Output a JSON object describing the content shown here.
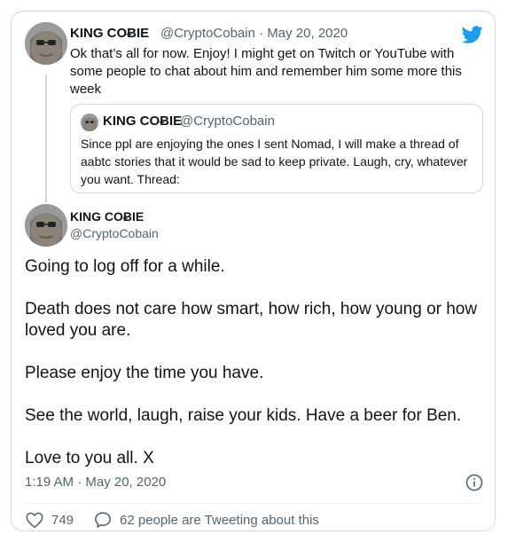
{
  "reply_tweet": {
    "author_name": "KING COɃIE",
    "author_handle": "@CryptoCobain",
    "separator": "·",
    "date": "May 20, 2020",
    "text": "Ok that’s all for now. Enjoy! I might get on Twitch or YouTube with some people to chat about him and remember him some more this week"
  },
  "quoted_tweet": {
    "author_name": "KING COɃIE",
    "author_handle": "@CryptoCobain",
    "text": "Since ppl are enjoying the ones I sent Nomad, I will make a thread of aabtc stories that it would be sad to keep private. Laugh, cry, whatever you want. Thread:"
  },
  "main_tweet": {
    "author_name": "KING COɃIE",
    "author_handle": "@CryptoCobain",
    "paragraphs": [
      "Going to log off for a while.",
      "Death does not care how smart, how rich, how young or how loved you are.",
      "Please enjoy the time you have.",
      "See the world, laugh, raise your kids. Have a beer for Ben.",
      "Love to you all. X"
    ],
    "timestamp": "1:19 AM · May 20, 2020"
  },
  "actions": {
    "like_count": "749",
    "retweet_text": "62 people are Tweeting about this"
  },
  "colors": {
    "twitter_blue": "#1d9bf0",
    "secondary_text": "#536471",
    "border": "#cfd9de"
  },
  "icons": [
    "twitter-bird-icon",
    "info-icon",
    "heart-icon",
    "comment-icon"
  ]
}
